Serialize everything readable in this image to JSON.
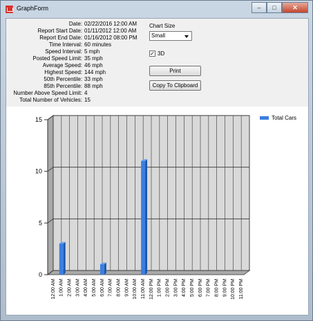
{
  "window": {
    "title": "GraphForm",
    "controls": [
      "–",
      "□",
      "✕"
    ]
  },
  "report_info": [
    {
      "label": "Date:",
      "value": "02/22/2016 12:00 AM"
    },
    {
      "label": "Report Start Date:",
      "value": "01/11/2012 12:00 AM"
    },
    {
      "label": "Report End Date:",
      "value": "01/16/2012 08:00 PM"
    },
    {
      "label": "Time Interval:",
      "value": "60 minutes"
    },
    {
      "label": "Speed Interval:",
      "value": "5  mph"
    },
    {
      "label": "Posted Speed Limit:",
      "value": "35  mph"
    },
    {
      "label": "Average Speed:",
      "value": "46  mph"
    },
    {
      "label": "Highest Speed:",
      "value": "144  mph"
    },
    {
      "label": "50th Percentile:",
      "value": "33  mph"
    },
    {
      "label": "85th Percentile:",
      "value": "88  mph"
    },
    {
      "label": "Number Above Speed Limit:",
      "value": "4"
    },
    {
      "label": "Total Number of Vehicles:",
      "value": "15"
    }
  ],
  "controls": {
    "chart_size_label": "Chart Size",
    "chart_size_value": "Small",
    "three_d_label": "3D",
    "three_d_checked": true,
    "print_label": "Print",
    "copy_label": "Copy To Clipboard"
  },
  "chart_data": {
    "type": "bar",
    "three_d": true,
    "categories": [
      "12:00 AM",
      "1:00 AM",
      "2:00 AM",
      "3:00 AM",
      "4:00 AM",
      "5:00 AM",
      "6:00 AM",
      "7:00 AM",
      "8:00 AM",
      "9:00 AM",
      "10:00 AM",
      "11:00 AM",
      "12:00 PM",
      "1:00 PM",
      "2:00 PM",
      "3:00 PM",
      "4:00 PM",
      "5:00 PM",
      "6:00 PM",
      "7:00 PM",
      "8:00 PM",
      "9:00 PM",
      "10:00 PM",
      "11:00 PM"
    ],
    "series": [
      {
        "name": "Total Cars",
        "color": "#3a7fe0",
        "values": [
          0,
          3,
          0,
          0,
          0,
          0,
          1,
          0,
          0,
          0,
          0,
          11,
          0,
          0,
          0,
          0,
          0,
          0,
          0,
          0,
          0,
          0,
          0,
          0
        ]
      }
    ],
    "y_ticks": [
      0,
      5,
      10,
      15
    ],
    "ylim": [
      0,
      15
    ],
    "grid": true,
    "legend": "top-right"
  }
}
